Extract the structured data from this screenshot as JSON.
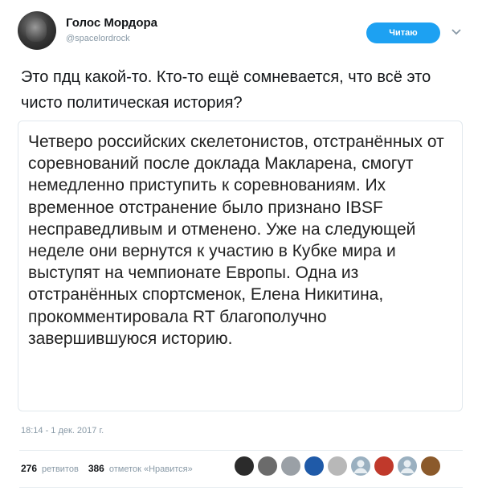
{
  "header": {
    "display_name": "Голос Мордора",
    "handle": "@spacelordrock",
    "follow_label": "Читаю",
    "accent_color": "#1da1f2"
  },
  "tweet": {
    "text": "Это пдц какой-то. Кто-то ещё сомневается, что всё это чисто политическая история?"
  },
  "quote": {
    "text": "Четверо российских скелетонистов, отстранённых от соревнований после доклада Макларена, смогут немедленно приступить к соревнованиям. Их временное отстранение было признано IBSF несправедливым и отменено. Уже на следующей неделе они вернутся к участию в Кубке мира и выступят на чемпионате Европы. Одна из отстранённых спортсменок, Елена Никитина, прокомментировала RT благополучно завершившуюся историю."
  },
  "meta": {
    "timestamp": "18:14 - 1 дек. 2017 г."
  },
  "stats": {
    "retweets_count": "276",
    "retweets_label": "ретвитов",
    "likes_count": "386",
    "likes_label": "отметок «Нравится»"
  },
  "likers": [
    {
      "icon": "avatar-dark-icon",
      "color": "#2b2b2b"
    },
    {
      "icon": "avatar-grey-icon",
      "color": "#6b6b6b"
    },
    {
      "icon": "avatar-sketch-icon",
      "color": "#9aa0a6"
    },
    {
      "icon": "avatar-blue-icon",
      "color": "#1f5aa8"
    },
    {
      "icon": "avatar-light-icon",
      "color": "#b8b8b8"
    },
    {
      "icon": "avatar-default-icon",
      "color": "#9ab0c0"
    },
    {
      "icon": "avatar-red-icon",
      "color": "#c0392b"
    },
    {
      "icon": "avatar-default-icon",
      "color": "#9ab0c0"
    },
    {
      "icon": "avatar-brown-icon",
      "color": "#8b5a2b"
    }
  ]
}
